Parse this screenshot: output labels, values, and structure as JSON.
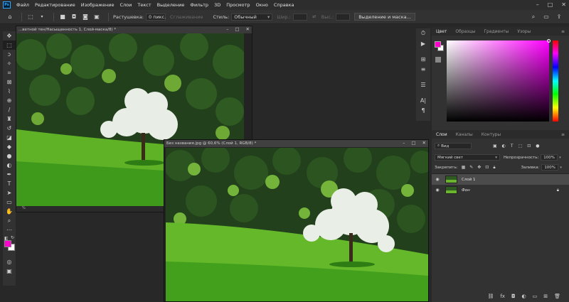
{
  "app": {
    "logo": "Ps"
  },
  "menu": [
    "Файл",
    "Редактирование",
    "Изображение",
    "Слои",
    "Текст",
    "Выделение",
    "Фильтр",
    "3D",
    "Просмотр",
    "Окно",
    "Справка"
  ],
  "options": {
    "feather_label": "Растушевка:",
    "feather_value": "0 пикс.",
    "antialias_label": "Сглаживание",
    "style_label": "Стиль:",
    "style_value": "Обычный",
    "width_label": "Шир.:",
    "height_label": "Выс.:",
    "select_mask_button": "Выделение и маска..."
  },
  "documents": [
    {
      "title": "...ветной тен/Насыщенность 1, Слой-маска/8) *",
      "status": "%"
    },
    {
      "title": "Без названия.jpg @ 60,6% (Слой 1, RGB/8) *"
    }
  ],
  "color_panel": {
    "tabs": [
      "Цвет",
      "Образцы",
      "Градиенты",
      "Узоры"
    ],
    "foreground": "#ff00cc",
    "background": "#ffffff"
  },
  "layers_panel": {
    "tabs": [
      "Слои",
      "Каналы",
      "Контуры"
    ],
    "filter_value": "Вид",
    "blend_mode": "Мягкий свет",
    "opacity_label": "Непрозрачность:",
    "opacity_value": "100%",
    "lock_label": "Закрепить:",
    "fill_label": "Заливка:",
    "fill_value": "100%",
    "layers": [
      {
        "name": "Слой 1",
        "selected": true
      },
      {
        "name": "Фон",
        "selected": false,
        "locked": true
      }
    ]
  },
  "colors": {
    "accent_fg": "#ff00cc",
    "ps_blue": "#31a8ff"
  }
}
